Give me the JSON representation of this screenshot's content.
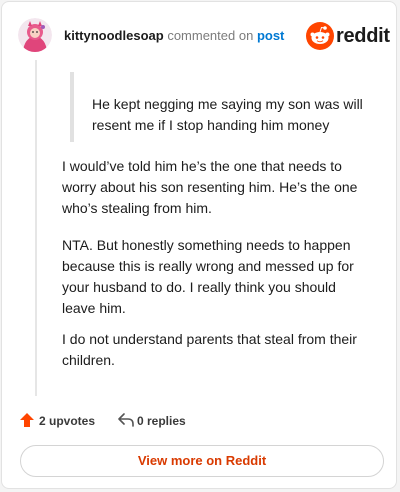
{
  "header": {
    "username": "kittynoodlesoap",
    "action_text": "commented on",
    "post_link": "post",
    "logo_text": "reddit"
  },
  "comment": {
    "quote": "He kept negging me saying my son was will resent me if I stop handing him money",
    "paragraphs": [
      "I would’ve told him he’s the one that needs to worry about his son resenting him. He’s the one who’s stealing from him.",
      "NTA. But honestly something needs to happen because this is really wrong and messed up for your husband to do. I really think you should leave him.",
      "I do not understand parents that steal from their children."
    ]
  },
  "footer": {
    "upvotes": "2 upvotes",
    "replies": "0 replies",
    "view_more": "View more on Reddit"
  },
  "colors": {
    "accent": "#ff4500",
    "link": "#0079d3",
    "button_text": "#d93a00"
  }
}
